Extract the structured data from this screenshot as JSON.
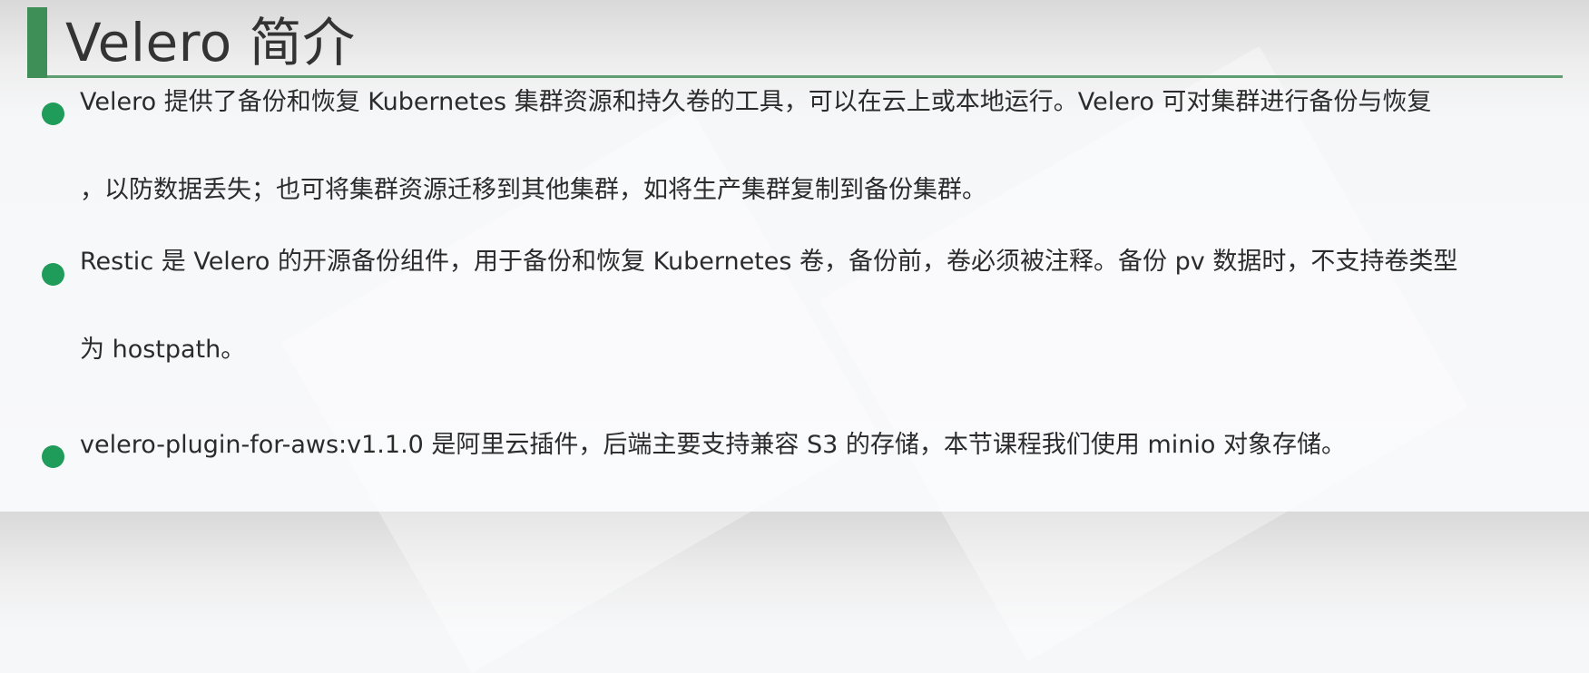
{
  "slide": {
    "title": "Velero 简介",
    "accent_color": "#3e8f57",
    "bullet_color": "#1f9b5a",
    "bullets": [
      {
        "lines": [
          "Velero 提供了备份和恢复 Kubernetes 集群资源和持久卷的工具，可以在云上或本地运行。Velero 可对集群进行备份与恢复",
          "，以防数据丢失；也可将集群资源迁移到其他集群，如将生产集群复制到备份集群。"
        ]
      },
      {
        "lines": [
          "Restic 是 Velero 的开源备份组件，用于备份和恢复 Kubernetes 卷，备份前，卷必须被注释。备份 pv 数据时，不支持卷类型",
          "为 hostpath。"
        ]
      },
      {
        "lines": [
          "velero-plugin-for-aws:v1.1.0 是阿里云插件，后端主要支持兼容 S3 的存储，本节课程我们使用 minio 对象存储。"
        ]
      }
    ]
  }
}
